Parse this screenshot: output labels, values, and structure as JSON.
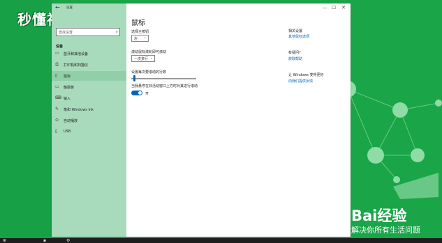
{
  "watermark": "秒懂视频",
  "brand": {
    "logo": "Bai经验",
    "slogan": "解决你所有生活问题"
  },
  "window": {
    "back_glyph": "←",
    "title": "设置",
    "controls": [
      "—",
      "☐",
      "✕"
    ]
  },
  "sidebar": {
    "search_placeholder": "查找设置",
    "section": "设备",
    "items": [
      {
        "label": "蓝牙和其他设备",
        "icon": "▭"
      },
      {
        "label": "打印机和扫描仪",
        "icon": "⎙"
      },
      {
        "label": "鼠标",
        "icon": "▯"
      },
      {
        "label": "触摸板",
        "icon": "▭"
      },
      {
        "label": "输入",
        "icon": "⌨"
      },
      {
        "label": "笔和 Windows Ink",
        "icon": "✎"
      },
      {
        "label": "自动播放",
        "icon": "⊙"
      },
      {
        "label": "USB",
        "icon": "▯"
      }
    ]
  },
  "content": {
    "title": "鼠标",
    "primary_button_label": "选择主按钮",
    "primary_button_value": "左",
    "scroll_label": "滚动鼠标滚轮即可滚动",
    "scroll_value": "一次多行",
    "lines_label": "设置每次要滚动的行数",
    "lines_value_fraction": 0.03,
    "inactive_scroll_label": "当我悬停在非活动窗口上方时对其进行滚动",
    "toggle_state": "开"
  },
  "related": {
    "heading1": "相关设置",
    "link1": "其他鼠标选项",
    "heading2": "有疑问?",
    "link2": "获取帮助",
    "heading3": "让 Windows 变得更好",
    "link3": "向我们提供反馈"
  },
  "colors": {
    "desktop": "#1aa548",
    "sidebar": "#a8dbbc",
    "accent": "#0067b8"
  }
}
